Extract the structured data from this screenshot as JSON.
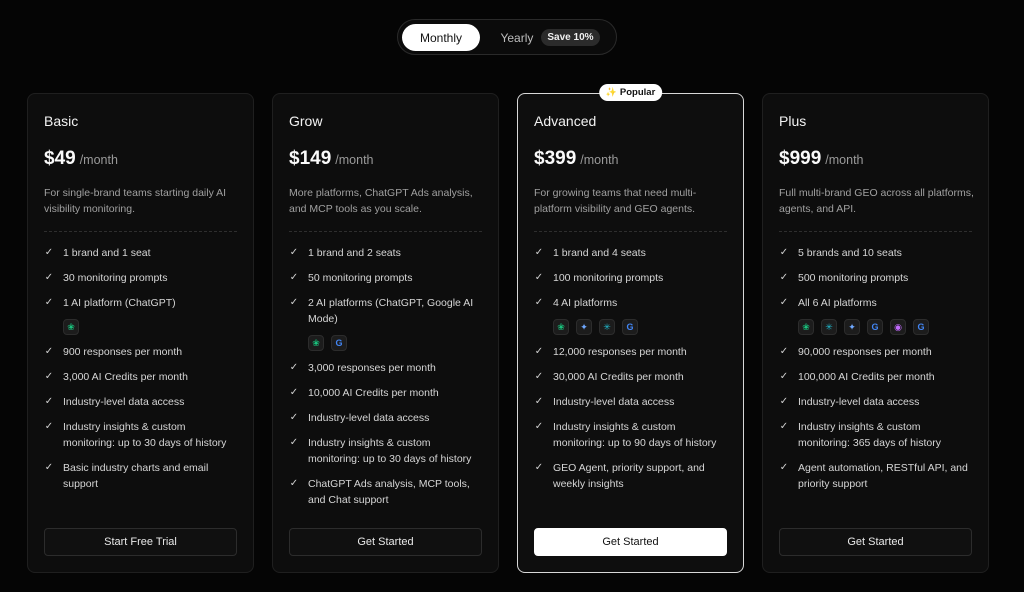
{
  "billing_toggle": {
    "monthly_label": "Monthly",
    "yearly_label": "Yearly",
    "save_badge": "Save 10%",
    "selected": "Monthly"
  },
  "popular_badge": "Popular",
  "colors": {
    "background": "#050505",
    "card": "#0d0d0d",
    "featured_border": "#d8d8d8",
    "primary_button": "#ffffff"
  },
  "plans": [
    {
      "name": "Basic",
      "price": "$49",
      "period": "/month",
      "description": "For single-brand teams starting daily AI visibility monitoring.",
      "features": [
        {
          "text": "1 brand and 1 seat"
        },
        {
          "text": "30 monitoring prompts"
        },
        {
          "text": "1 AI platform (ChatGPT)",
          "icons": [
            "chatgpt-icon"
          ]
        },
        {
          "text": "900 responses per month"
        },
        {
          "text": "3,000 AI Credits per month"
        },
        {
          "text": "Industry-level data access"
        },
        {
          "text": "Industry insights & custom monitoring: up to 30 days of history"
        },
        {
          "text": "Basic industry charts and email support"
        }
      ],
      "cta": "Start Free Trial"
    },
    {
      "name": "Grow",
      "price": "$149",
      "period": "/month",
      "description": "More platforms, ChatGPT Ads analysis, and MCP tools as you scale.",
      "features": [
        {
          "text": "1 brand and 2 seats"
        },
        {
          "text": "50 monitoring prompts"
        },
        {
          "text": "2 AI platforms (ChatGPT, Google AI Mode)",
          "icons": [
            "chatgpt-icon",
            "google-icon"
          ]
        },
        {
          "text": "3,000 responses per month"
        },
        {
          "text": "10,000 AI Credits per month"
        },
        {
          "text": "Industry-level data access"
        },
        {
          "text": "Industry insights & custom monitoring: up to 30 days of history"
        },
        {
          "text": "ChatGPT Ads analysis, MCP tools, and Chat support"
        }
      ],
      "cta": "Get Started"
    },
    {
      "name": "Advanced",
      "price": "$399",
      "period": "/month",
      "description": "For growing teams that need multi-platform visibility and GEO agents.",
      "features": [
        {
          "text": "1 brand and 4 seats"
        },
        {
          "text": "100 monitoring prompts"
        },
        {
          "text": "4 AI platforms",
          "icons": [
            "chatgpt-icon",
            "gemini-icon",
            "perplexity-icon",
            "google-icon"
          ]
        },
        {
          "text": "12,000 responses per month"
        },
        {
          "text": "30,000 AI Credits per month"
        },
        {
          "text": "Industry-level data access"
        },
        {
          "text": "Industry insights & custom monitoring: up to 90 days of history"
        },
        {
          "text": "GEO Agent, priority support, and weekly insights"
        }
      ],
      "cta": "Get Started",
      "featured": true
    },
    {
      "name": "Plus",
      "price": "$999",
      "period": "/month",
      "description": "Full multi-brand GEO across all platforms, agents, and API.",
      "features": [
        {
          "text": "5 brands and 10 seats"
        },
        {
          "text": "500 monitoring prompts"
        },
        {
          "text": "All 6 AI platforms",
          "icons": [
            "chatgpt-icon",
            "perplexity-icon",
            "gemini-icon",
            "google-icon",
            "copilot-icon",
            "google-icon"
          ]
        },
        {
          "text": "90,000 responses per month"
        },
        {
          "text": "100,000 AI Credits per month"
        },
        {
          "text": "Industry-level data access"
        },
        {
          "text": "Industry insights & custom monitoring: 365 days of history"
        },
        {
          "text": "Agent automation, RESTful API, and priority support"
        }
      ],
      "cta": "Get Started"
    }
  ]
}
